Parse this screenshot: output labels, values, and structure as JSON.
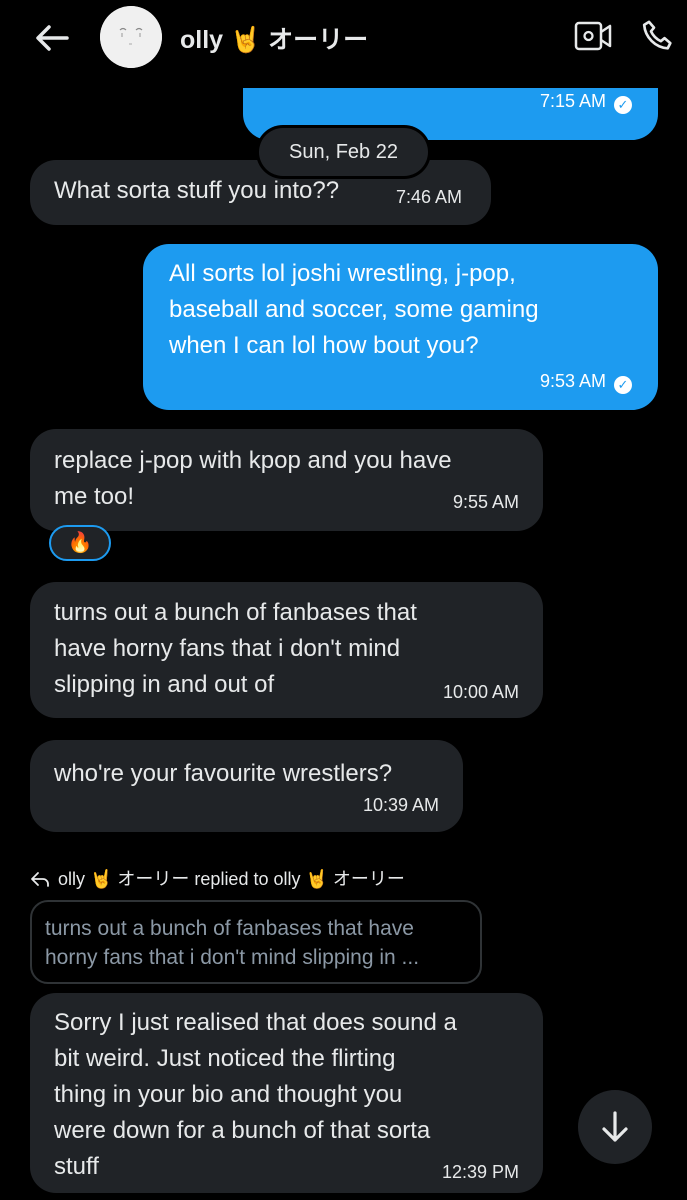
{
  "header": {
    "title": "olly 🤘 オーリー"
  },
  "chat": {
    "date_separator": "Sun, Feb 22",
    "messages": [
      {
        "direction": "sent",
        "text": "",
        "time": "7:15 AM"
      },
      {
        "direction": "received",
        "text": "What sorta stuff you into??",
        "time": "7:46 AM"
      },
      {
        "direction": "sent",
        "text": "All sorts lol joshi wrestling, j-pop,\nbaseball and soccer, some gaming\nwhen I can lol how bout you?",
        "time": "9:53 AM"
      },
      {
        "direction": "received",
        "text": "replace j-pop with kpop and you have\nme too!",
        "time": "9:55 AM",
        "reaction": "🔥"
      },
      {
        "direction": "received",
        "text": "turns out a bunch of fanbases that\nhave horny fans that i don't mind\nslipping in and out of",
        "time": "10:00 AM"
      },
      {
        "direction": "received",
        "text": "who're your favourite wrestlers?",
        "time": "10:39 AM"
      },
      {
        "direction": "received",
        "text": "Sorry I just realised that does sound a\nbit weird. Just noticed the flirting\nthing in your bio and thought you\nwere down for a bunch of that sorta\nstuff",
        "time": "12:39 PM"
      }
    ],
    "reply": {
      "header": "olly 🤘 オーリー replied to olly 🤘 オーリー",
      "quoted_text": "turns out a bunch of fanbases that have\nhorny fans that i don't mind slipping in ..."
    }
  },
  "colors": {
    "background": "#000000",
    "sent_bubble": "#1d9bf0",
    "received_bubble": "#202327",
    "text": "#e7e9ea"
  },
  "icons": [
    "back-arrow-icon",
    "video-call-icon",
    "phone-icon",
    "read-check-icon",
    "reply-arrow-icon",
    "arrow-down-icon"
  ]
}
